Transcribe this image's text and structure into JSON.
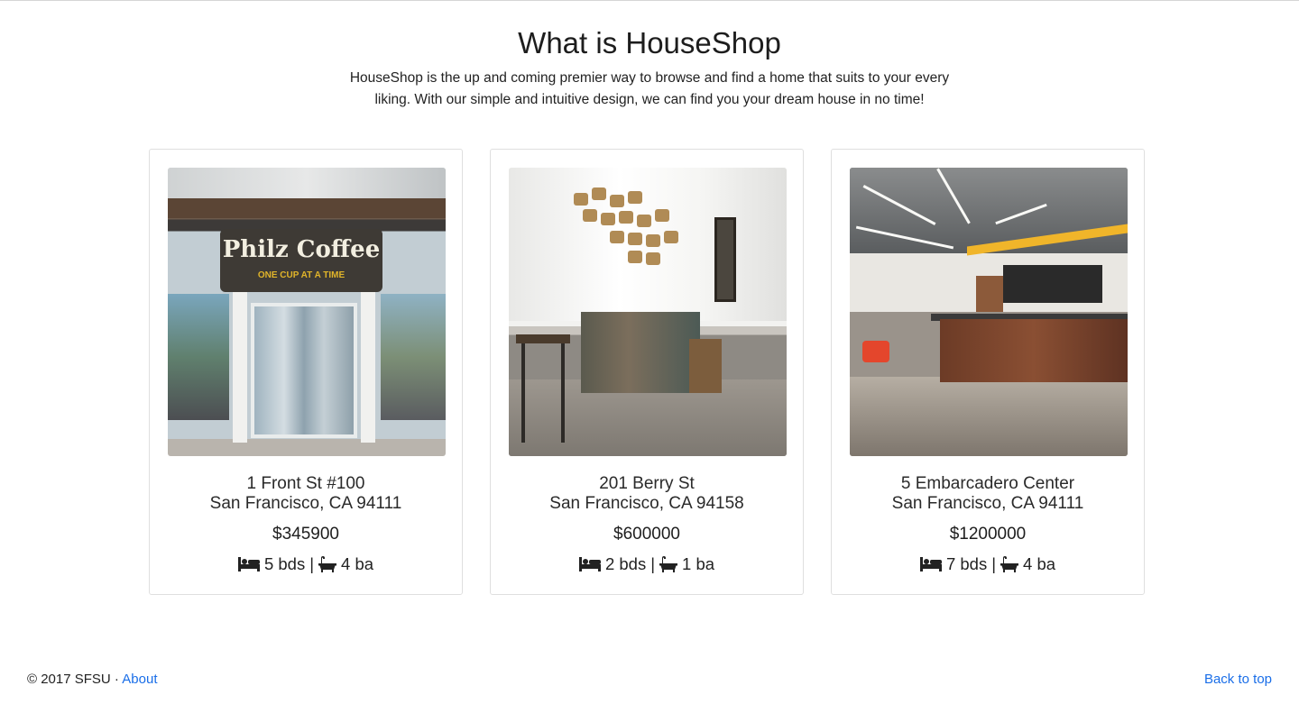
{
  "intro": {
    "title": "What is HouseShop",
    "description": "HouseShop is the up and coming premier way to browse and find a home that suits to your every liking. With our simple and intuitive design, we can find you your dream house in no time!"
  },
  "listings": [
    {
      "address_line1": "1 Front St #100",
      "address_line2": "San Francisco, CA 94111",
      "price": "$345900",
      "beds": "5 bds",
      "separator": "|",
      "baths": "4 ba",
      "sign_text": "Philz Coffee",
      "sign_tagline": "ONE CUP AT A TIME"
    },
    {
      "address_line1": "201 Berry St",
      "address_line2": "San Francisco, CA 94158",
      "price": "$600000",
      "beds": "2 bds",
      "separator": "|",
      "baths": "1 ba"
    },
    {
      "address_line1": "5 Embarcadero Center",
      "address_line2": "San Francisco, CA 94111",
      "price": "$1200000",
      "beds": "7 bds",
      "separator": "|",
      "baths": "4 ba"
    }
  ],
  "footer": {
    "copyright": "© 2017 SFSU ·",
    "about_link": "About",
    "back_to_top": "Back to top"
  },
  "icons": {
    "bed": "bed-icon",
    "bath": "bath-icon"
  },
  "colors": {
    "link": "#1a6ee8",
    "card_border": "#dfdfdf"
  }
}
